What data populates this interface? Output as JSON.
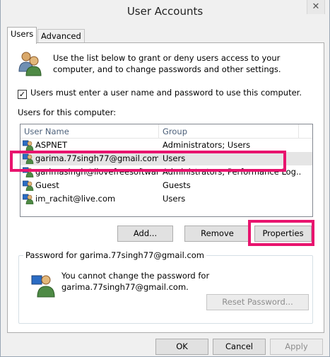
{
  "window": {
    "title": "User Accounts",
    "close_glyph": "✕"
  },
  "tabs": [
    {
      "label": "Users"
    },
    {
      "label": "Advanced"
    }
  ],
  "intro": {
    "text": "Use the list below to grant or deny users access to your computer, and to change passwords and other settings.",
    "icon": "users-icon"
  },
  "checkbox": {
    "label": "Users must enter a user name and password to use this computer.",
    "checked": true,
    "check_glyph": "✓"
  },
  "users_list": {
    "label": "Users for this computer:",
    "columns": [
      "User Name",
      "Group"
    ],
    "rows": [
      {
        "name": "ASPNET",
        "group": "Administrators; Users"
      },
      {
        "name": "garima.77singh77@gmail.com",
        "group": "Users"
      },
      {
        "name": "garimasingh@ilovefreesoftwar...",
        "group": "Administrators; Performance Log..."
      },
      {
        "name": "Guest",
        "group": "Guests"
      },
      {
        "name": "im_rachit@live.com",
        "group": "Users"
      }
    ],
    "selected_index": 1
  },
  "buttons": {
    "add": "Add...",
    "remove": "Remove",
    "properties": "Properties"
  },
  "password_group": {
    "label": "Password for garima.77singh77@gmail.com",
    "text": "You cannot change the password for garima.77singh77@gmail.com.",
    "reset_button": "Reset Password..."
  },
  "dialog_buttons": {
    "ok": "OK",
    "cancel": "Cancel",
    "apply": "Apply"
  },
  "colors": {
    "highlight": "#e8146e",
    "selected_row": "#e5e5e5",
    "header_text": "#4c607a"
  }
}
